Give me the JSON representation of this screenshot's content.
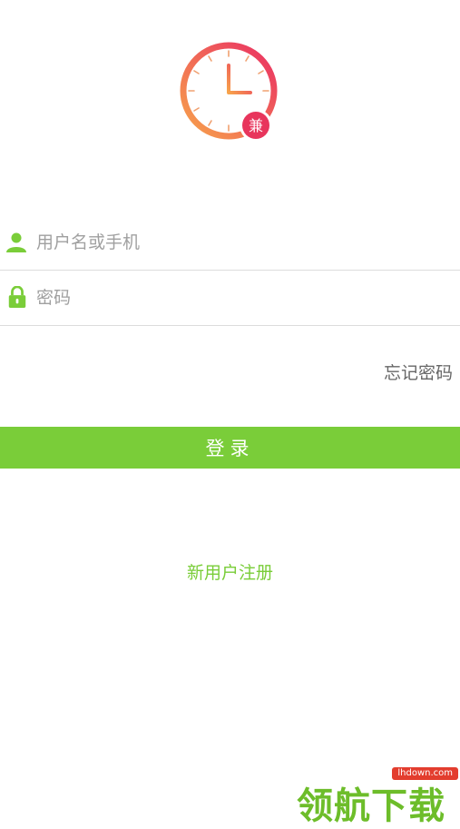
{
  "logo": {
    "badge": "兼",
    "icon": "clock-icon"
  },
  "form": {
    "username_placeholder": "用户名或手机",
    "username_value": "",
    "password_placeholder": "密码",
    "password_value": "",
    "user_icon": "user-icon",
    "lock_icon": "lock-icon"
  },
  "forgot_label": "忘记密码",
  "login_label": "登录",
  "register_label": "新用户注册",
  "watermark": {
    "text": "领航下载",
    "tag": "lhdown.com"
  },
  "colors": {
    "accent": "#7acd39",
    "logo_start": "#f7a34b",
    "logo_end": "#ea2f63"
  }
}
